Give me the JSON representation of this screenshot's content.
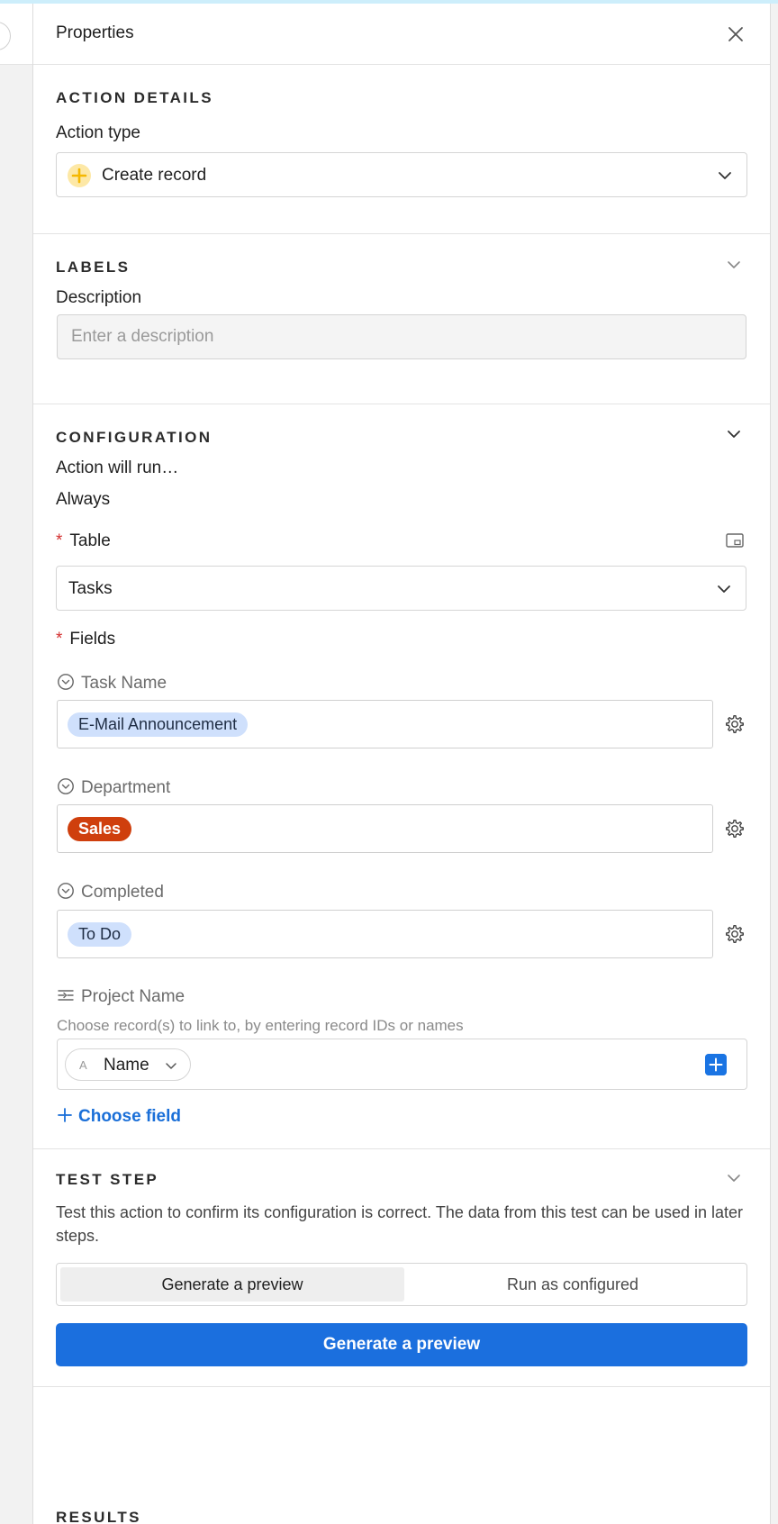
{
  "header": {
    "title": "Properties",
    "close_icon": "close-icon"
  },
  "action_details": {
    "title": "ACTION DETAILS",
    "action_type_label": "Action type",
    "action_type_value": "Create record",
    "action_type_icon": "plus-circle-icon",
    "accent_color": "#f7c948"
  },
  "labels": {
    "title": "LABELS",
    "description_label": "Description",
    "description_placeholder": "Enter a description",
    "description_value": ""
  },
  "configuration": {
    "title": "CONFIGURATION",
    "run_label": "Action will run…",
    "run_value": "Always",
    "required_mark": "*",
    "table_label": "Table",
    "table_value": "Tasks",
    "fields_label": "Fields",
    "fields": [
      {
        "label": "Task Name",
        "value": "E-Mail Announcement",
        "tag_color": "#cfe0fc"
      },
      {
        "label": "Department",
        "value": "Sales",
        "tag_color": "#cf3f0d"
      },
      {
        "label": "Completed",
        "value": "To Do",
        "tag_color": "#cfe0fc"
      }
    ],
    "link_field": {
      "label": "Project Name",
      "hint": "Choose record(s) to link to, by entering record IDs or names",
      "chip_prefix": "A",
      "chip_label": "Name"
    },
    "choose_field_label": "Choose field"
  },
  "test_step": {
    "title": "TEST STEP",
    "description": "Test this action to confirm its configuration is correct. The data from this test can be used in later steps.",
    "options": [
      "Generate a preview",
      "Run as configured"
    ],
    "selected_option": "Generate a preview",
    "button_label": "Generate a preview",
    "button_color": "#1b6fde"
  },
  "results": {
    "title": "RESULTS"
  }
}
